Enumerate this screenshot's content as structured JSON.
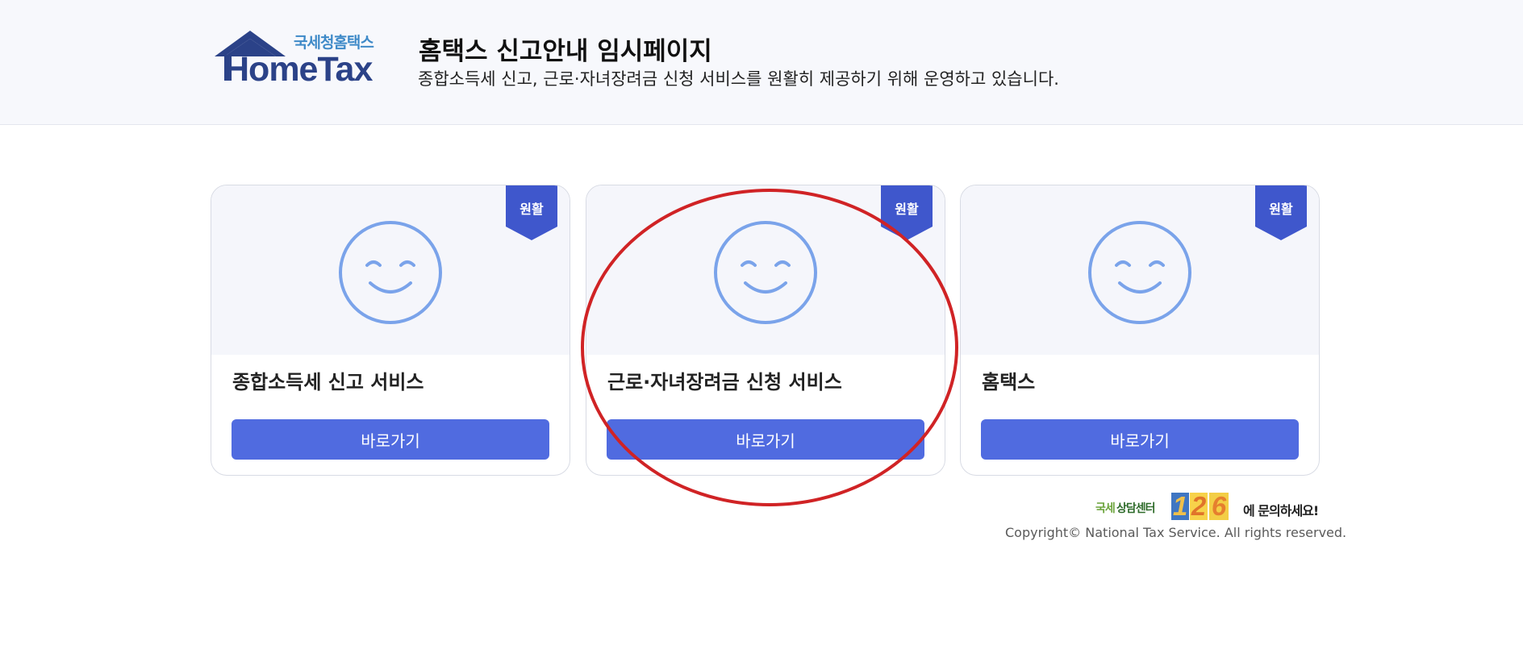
{
  "header": {
    "logo": {
      "sub_text": "국세청홈택스",
      "main_text": "HomeTax"
    },
    "title": "홈택스 신고안내 임시페이지",
    "subtitle": "종합소득세 신고, 근로·자녀장려금 신청 서비스를 원활히 제공하기 위해 운영하고 있습니다."
  },
  "cards": [
    {
      "badge": "원활",
      "title": "종합소득세 신고 서비스",
      "button": "바로가기",
      "icon": "smiley-icon"
    },
    {
      "badge": "원활",
      "title": "근로·자녀장려금 신청 서비스",
      "button": "바로가기",
      "icon": "smiley-icon"
    },
    {
      "badge": "원활",
      "title": "홈택스",
      "button": "바로가기",
      "icon": "smiley-icon"
    }
  ],
  "footer": {
    "contact": {
      "prefix_a": "국세",
      "prefix_b": "상담센터",
      "digits": [
        "1",
        "2",
        "6"
      ],
      "suffix": "에 문의하세요!"
    },
    "copyright": "Copyright© National Tax Service. All rights reserved."
  },
  "colors": {
    "header_bg": "#f7f8fc",
    "card_top_bg": "#f5f6fb",
    "button": "#506be0",
    "badge": "#3f57cc",
    "smiley": "#7aa3ea",
    "annotation_circle": "#d02325",
    "logo_navy": "#2b4288",
    "logo_sub": "#3f8ac8"
  }
}
